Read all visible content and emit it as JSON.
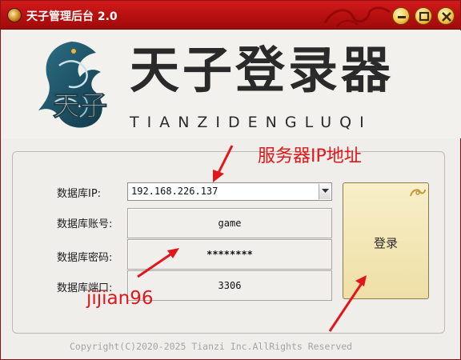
{
  "window": {
    "title": "天子管理后台 2.0",
    "controls": [
      "minimize-icon",
      "maximize-icon",
      "close-icon"
    ],
    "accent_color": "#c01414"
  },
  "banner": {
    "brand_text": "天子登录器",
    "brand_pinyin": "TIANZIDENGLUQI",
    "logo": "dragon-logo"
  },
  "form": {
    "ip_label": "数据库IP:",
    "ip_value": "192.168.226.137",
    "account_label": "数据库账号:",
    "account_value": "game",
    "password_label": "数据库密码:",
    "password_value": "********",
    "port_label": "数据库端口:",
    "port_value": "3306"
  },
  "login_button": {
    "label": "登录"
  },
  "footer": {
    "copyright": "Copyright(C)2020-2025 Tianzi Inc.AllRights Reserved"
  },
  "annotations": {
    "server_ip_note": "服务器IP地址",
    "watermark": "jijian96",
    "color": "#e0161a"
  }
}
